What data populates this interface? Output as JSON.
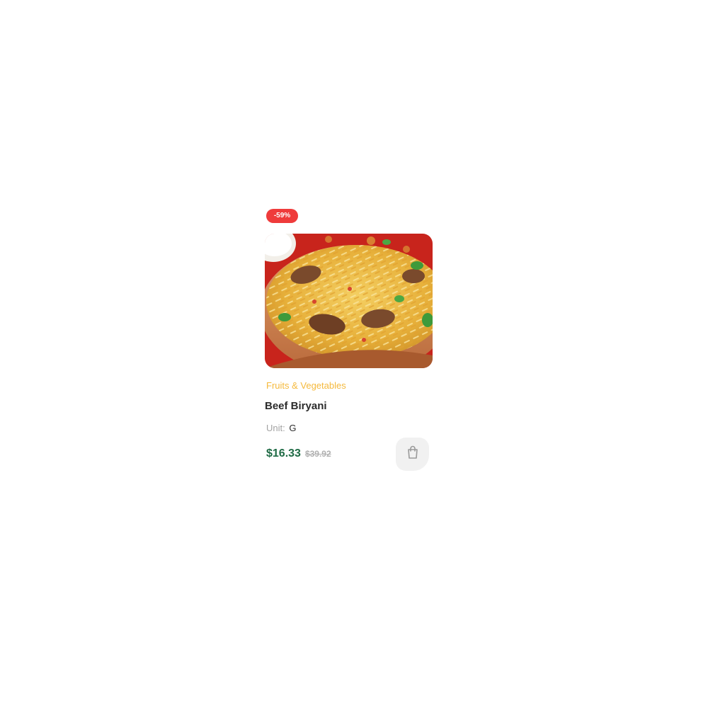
{
  "product": {
    "discount_badge": "-59%",
    "image_alt": "Beef Biryani",
    "category": "Fruits & Vegetables",
    "title": "Beef Biryani",
    "unit_label": "Unit:",
    "unit_value": "G",
    "price_current": "$16.33",
    "price_old": "$39.92",
    "cart_icon": "shopping-bag-icon"
  },
  "colors": {
    "badge": "#ef3b3b",
    "category": "#f5b93c",
    "price": "#1f6b45",
    "cart_button": "#f1f1f1",
    "cart_icon": "#9a9a9a"
  }
}
